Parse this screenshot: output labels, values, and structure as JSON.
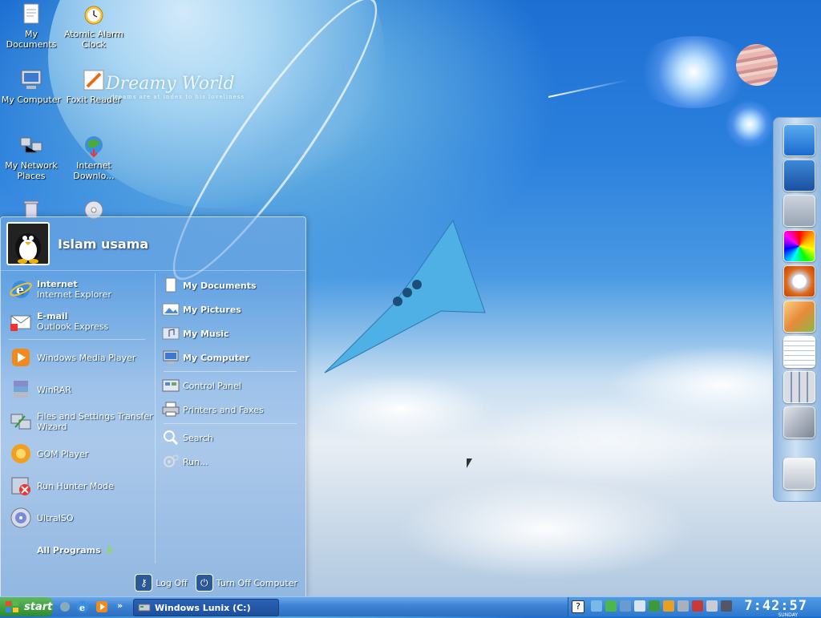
{
  "desktop": {
    "icons": [
      {
        "label": "My Documents"
      },
      {
        "label": "Atomic Alarm Clock"
      },
      {
        "label": "My Computer"
      },
      {
        "label": "Foxit Reader"
      },
      {
        "label": "My Network Places"
      },
      {
        "label": "Internet Downlo..."
      }
    ],
    "wallpaper_title": "Dreamy World",
    "wallpaper_tagline": "dreams are at index to his loveliness"
  },
  "start_menu": {
    "user_name": "Islam usama",
    "pinned": [
      {
        "title": "Internet",
        "subtitle": "Internet Explorer"
      },
      {
        "title": "E-mail",
        "subtitle": "Outlook Express"
      }
    ],
    "recent": [
      "Windows Media Player",
      "WinRAR",
      "Files and Settings Transfer Wizard",
      "GOM Player",
      "Run Hunter Mode",
      "UltraISO"
    ],
    "all_programs": "All Programs",
    "places": [
      "My Documents",
      "My Pictures",
      "My Music",
      "My Computer"
    ],
    "settings": [
      "Control Panel",
      "Printers and Faxes"
    ],
    "tools": [
      "Search",
      "Run..."
    ],
    "log_off": "Log Off",
    "turn_off": "Turn Off Computer"
  },
  "taskbar": {
    "start_label": "start",
    "more_label": "»",
    "task_label": "Windows Lunix (C:)",
    "clock": "7:42:57",
    "clock_sub": "SUNDAY"
  },
  "colors": {
    "accent": "#2e6fc0",
    "start_green": "#2d8a2d"
  }
}
